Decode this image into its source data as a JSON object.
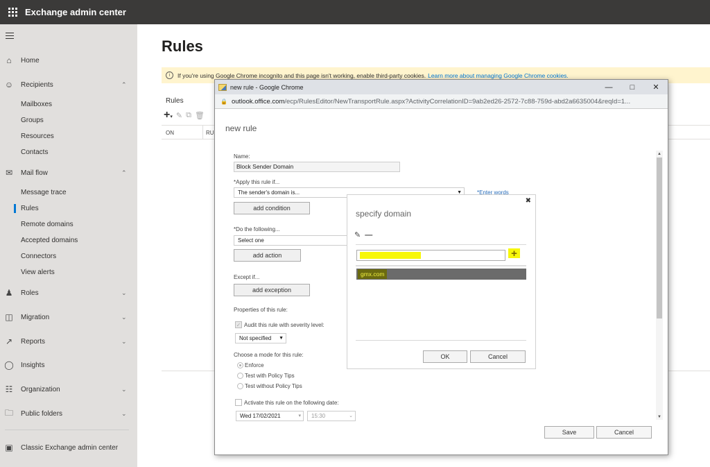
{
  "topbar": {
    "app_title": "Exchange admin center"
  },
  "sidebar": {
    "items": [
      {
        "label": "Home",
        "icon": "home-icon"
      },
      {
        "label": "Recipients",
        "icon": "person-icon",
        "expanded": true,
        "children": [
          "Mailboxes",
          "Groups",
          "Resources",
          "Contacts"
        ]
      },
      {
        "label": "Mail flow",
        "icon": "mail-icon",
        "expanded": true,
        "children": [
          "Message trace",
          "Rules",
          "Remote domains",
          "Accepted domains",
          "Connectors",
          "View alerts"
        ]
      },
      {
        "label": "Roles",
        "icon": "roles-icon",
        "expanded": false
      },
      {
        "label": "Migration",
        "icon": "migration-icon",
        "expanded": false
      },
      {
        "label": "Reports",
        "icon": "chart-icon",
        "expanded": false
      },
      {
        "label": "Insights",
        "icon": "lightbulb-icon"
      },
      {
        "label": "Organization",
        "icon": "org-icon",
        "expanded": false
      },
      {
        "label": "Public folders",
        "icon": "folder-icon",
        "expanded": false
      }
    ],
    "active_item": "Rules",
    "classic_link": "Classic Exchange admin center"
  },
  "main": {
    "page_title": "Rules",
    "banner": {
      "text": "If you're using Google Chrome incognito and this page isn't working, enable third-party cookies.",
      "link": "Learn more about managing Google Chrome cookies."
    },
    "rules_label": "Rules",
    "table_headers": [
      "ON",
      "RULE"
    ]
  },
  "popup": {
    "window_title": "new rule - Google Chrome",
    "url_host": "outlook.office.com",
    "url_path": "/ecp/RulesEditor/NewTransportRule.aspx?ActivityCorrelationID=9ab2ed26-2572-7c88-759d-abd2a6635004&reqId=1...",
    "heading": "new rule",
    "name_label": "Name:",
    "name_value": "Block Sender Domain",
    "apply_label": "*Apply this rule if...",
    "apply_value": "The sender's domain is...",
    "enter_words": "*Enter words",
    "add_condition": "add condition",
    "do_label": "*Do the following...",
    "do_value": "Select one",
    "add_action": "add action",
    "except_label": "Except if...",
    "add_exception": "add exception",
    "properties_label": "Properties of this rule:",
    "audit_label": "Audit this rule with severity level:",
    "audit_checked": true,
    "severity_value": "Not specified",
    "mode_label": "Choose a mode for this rule:",
    "modes": [
      "Enforce",
      "Test with Policy Tips",
      "Test without Policy Tips"
    ],
    "selected_mode": "Enforce",
    "activate_label": "Activate this rule on the following date:",
    "activate_checked": false,
    "date_value": "Wed 17/02/2021",
    "time_value": "15:30",
    "save": "Save",
    "cancel": "Cancel"
  },
  "domain_dialog": {
    "title": "specify domain",
    "input_value": "",
    "domains": [
      "gmx.com"
    ],
    "ok": "OK",
    "cancel": "Cancel",
    "highlight_color": "#f7f70a"
  }
}
